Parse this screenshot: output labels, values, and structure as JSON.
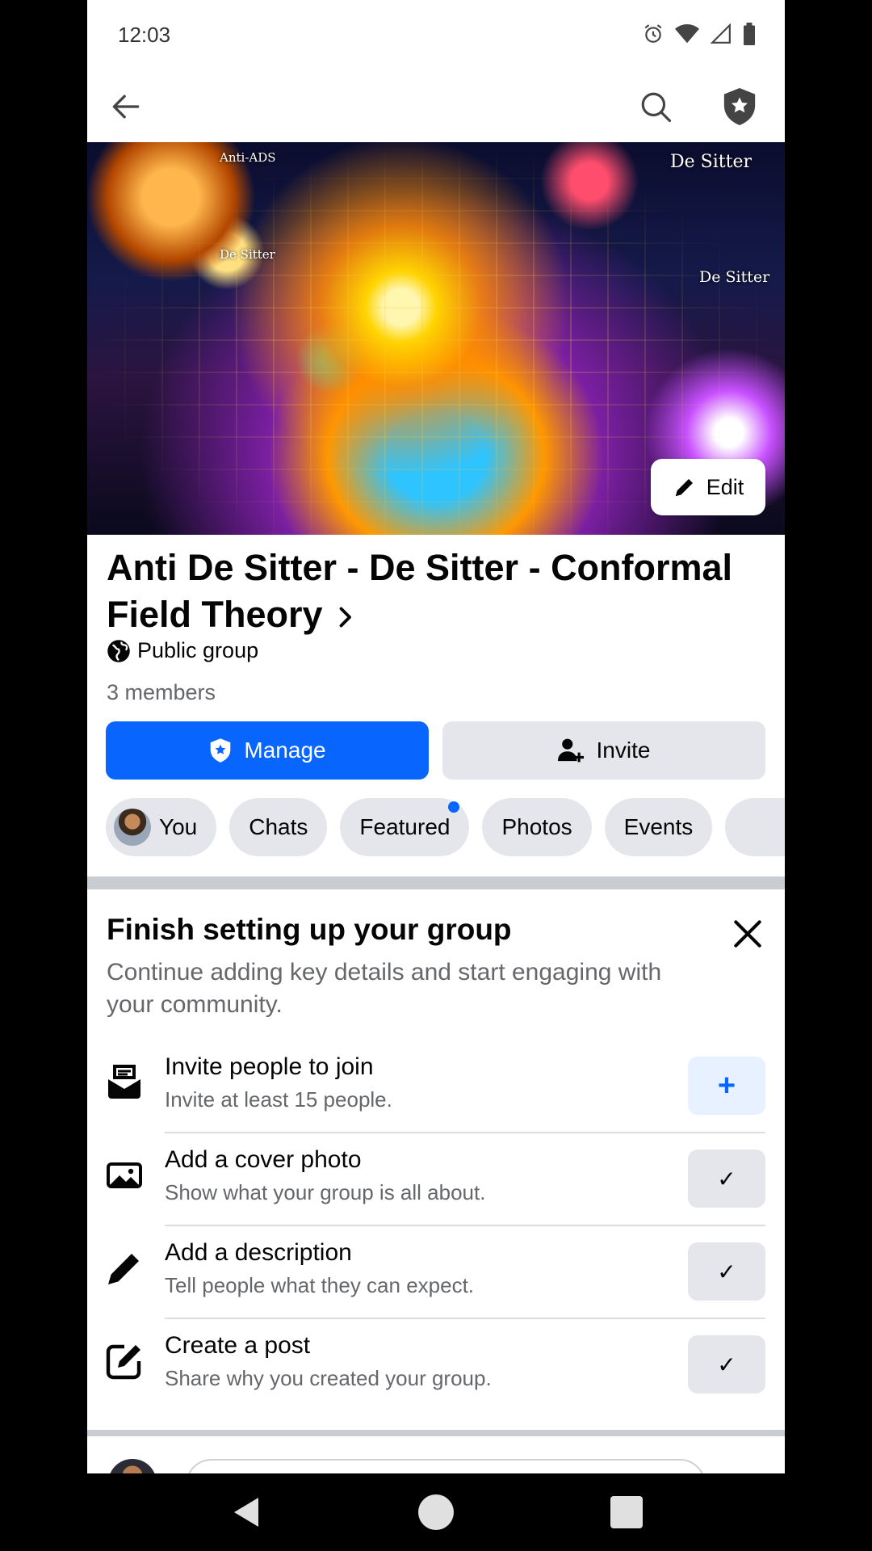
{
  "status_bar": {
    "time": "12:03"
  },
  "cover": {
    "labels": [
      "Anti-ADS",
      "De Sitter",
      "De Sitter",
      "De Sitter"
    ],
    "edit_label": "Edit"
  },
  "group": {
    "title": "Anti De Sitter - De Sitter - Conformal Field Theory",
    "privacy": "Public group",
    "members": "3 members"
  },
  "actions": {
    "manage_label": "Manage",
    "invite_label": "Invite"
  },
  "chips": [
    {
      "label": "You"
    },
    {
      "label": "Chats"
    },
    {
      "label": "Featured"
    },
    {
      "label": "Photos"
    },
    {
      "label": "Events"
    }
  ],
  "setup": {
    "title": "Finish setting up your group",
    "subtitle": "Continue adding key details and start engaging with your community.",
    "tasks": [
      {
        "title": "Invite people to join",
        "subtitle": "Invite at least 15 people.",
        "icon": "inbox-icon",
        "button": "+"
      },
      {
        "title": "Add a cover photo",
        "subtitle": "Show what your group is all about.",
        "icon": "photo-icon",
        "button": "✓"
      },
      {
        "title": "Add a description",
        "subtitle": "Tell people what they can expect.",
        "icon": "pencil-icon",
        "button": "✓"
      },
      {
        "title": "Create a post",
        "subtitle": "Share why you created your group.",
        "icon": "compose-icon",
        "button": "✓"
      }
    ]
  },
  "colors": {
    "accent": "#0866ff",
    "chip_bg": "#e4e6eb",
    "secondary_text": "#65676b"
  }
}
